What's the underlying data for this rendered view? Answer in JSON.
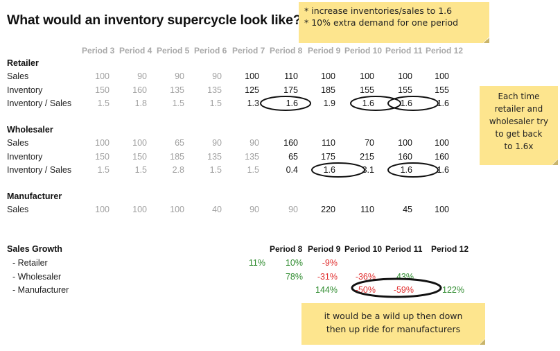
{
  "title": "What would an inventory supercycle look like?",
  "notes": {
    "assumptions": [
      "* increase inventories/sales to 1.6",
      "* 10% extra demand for one period"
    ],
    "retailer_wholesaler": [
      "Each time",
      "retailer and",
      "wholesaler try",
      "to get back",
      "to 1.6x"
    ],
    "manufacturer": [
      "it would be a wild up then down",
      "then up ride for manufacturers"
    ]
  },
  "periods": [
    "Period 3",
    "Period 4",
    "Period 5",
    "Period 6",
    "Period 7",
    "Period 8",
    "Period 9",
    "Period 10",
    "Period 11",
    "Period 12"
  ],
  "sections": {
    "retailer": {
      "title": "Retailer",
      "rows": [
        {
          "label": "Sales",
          "values": [
            "100",
            "90",
            "90",
            "90",
            "100",
            "110",
            "100",
            "100",
            "100",
            "100"
          ]
        },
        {
          "label": "Inventory",
          "values": [
            "150",
            "160",
            "135",
            "135",
            "125",
            "175",
            "185",
            "155",
            "155",
            "155"
          ]
        },
        {
          "label": "Inventory / Sales",
          "values": [
            "1.5",
            "1.8",
            "1.5",
            "1.5",
            "1.3",
            "1.6",
            "1.9",
            "1.6",
            "1.6",
            "1.6"
          ]
        }
      ]
    },
    "wholesaler": {
      "title": "Wholesaler",
      "rows": [
        {
          "label": "Sales",
          "values": [
            "100",
            "100",
            "65",
            "90",
            "90",
            "160",
            "110",
            "70",
            "100",
            "100"
          ]
        },
        {
          "label": "Inventory",
          "values": [
            "150",
            "150",
            "185",
            "135",
            "135",
            "65",
            "175",
            "215",
            "160",
            "160"
          ]
        },
        {
          "label": "Inventory / Sales",
          "values": [
            "1.5",
            "1.5",
            "2.8",
            "1.5",
            "1.5",
            "0.4",
            "1.6",
            "3.1",
            "1.6",
            "1.6"
          ]
        }
      ]
    },
    "manufacturer": {
      "title": "Manufacturer",
      "rows": [
        {
          "label": "Sales",
          "values": [
            "100",
            "100",
            "100",
            "40",
            "90",
            "90",
            "220",
            "110",
            "45",
            "100"
          ]
        }
      ]
    }
  },
  "growth": {
    "title": "Sales Growth",
    "periods": [
      "Period 8",
      "Period 9",
      "Period 10",
      "Period 11",
      "Period 12"
    ],
    "rows": [
      {
        "label": "- Retailer",
        "values": [
          "11%",
          "10%",
          "-9%",
          "",
          ""
        ]
      },
      {
        "label": "- Wholesaler",
        "values": [
          "",
          "78%",
          "-31%",
          "-36%",
          "43%"
        ]
      },
      {
        "label": "- Manufacturer",
        "values": [
          "",
          "",
          "144%",
          "-50%",
          "-59%",
          "122%"
        ]
      }
    ]
  },
  "colors": {
    "note": "#fde58e",
    "positive": "#2e8b2e",
    "negative": "#e03030",
    "historical": "#a0a0a0"
  }
}
